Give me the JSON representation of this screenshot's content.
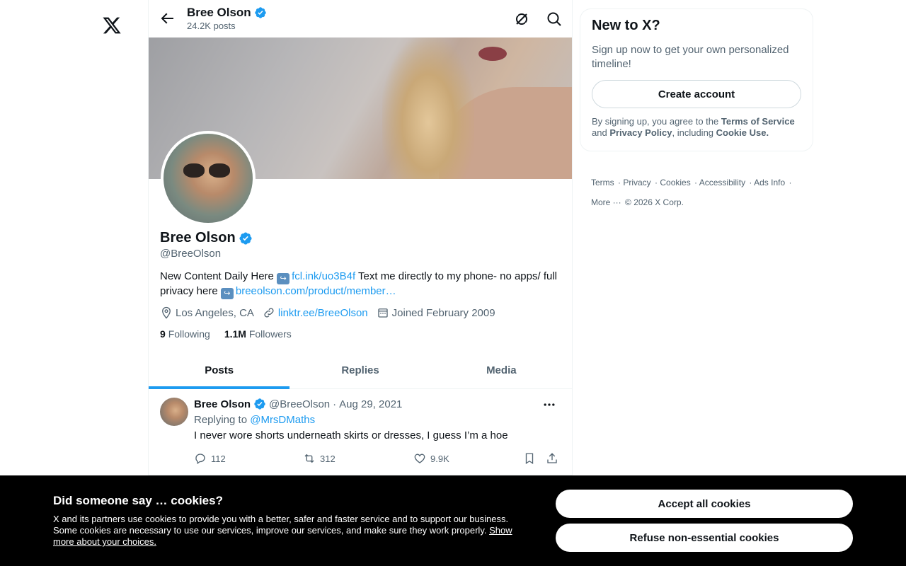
{
  "header": {
    "name": "Bree Olson",
    "posts_count": "24.2K posts"
  },
  "profile": {
    "name": "Bree Olson",
    "handle": "@BreeOlson",
    "bio_part1": "New Content Daily Here ",
    "bio_link1": "fcl.ink/uo3B4f",
    "bio_part2": " Text me directly to my phone- no apps/ full privacy here ",
    "bio_link2": "breeolson.com/product/member…",
    "location": "Los Angeles, CA",
    "website": "linktr.ee/BreeOlson",
    "joined": "Joined February 2009",
    "following_count": "9",
    "following_label": "Following",
    "followers_count": "1.1M",
    "followers_label": "Followers"
  },
  "tabs": [
    {
      "label": "Posts",
      "active": true
    },
    {
      "label": "Replies",
      "active": false
    },
    {
      "label": "Media",
      "active": false
    }
  ],
  "post": {
    "name": "Bree Olson",
    "handle": "@BreeOlson",
    "separator": "·",
    "date": "Aug 29, 2021",
    "replying_prefix": "Replying to ",
    "replying_to": "@MrsDMaths",
    "text": "I never wore shorts underneath skirts or dresses, I guess I’m a hoe",
    "replies": "112",
    "reposts": "312",
    "likes": "9.9K"
  },
  "signup": {
    "title": "New to X?",
    "subtitle": "Sign up now to get your own personalized timeline!",
    "create_button": "Create account",
    "terms_prefix": "By signing up, you agree to the ",
    "terms_link": "Terms of Service",
    "terms_mid": " and ",
    "privacy_link": "Privacy Policy",
    "terms_mid2": ", including ",
    "cookie_link": "Cookie Use."
  },
  "footer": {
    "links": [
      "Terms",
      "Privacy",
      "Cookies",
      "Accessibility",
      "Ads Info"
    ],
    "more": "More ···",
    "copyright": "© 2026 X Corp."
  },
  "cookie_banner": {
    "title": "Did someone say … cookies?",
    "body": "X and its partners use cookies to provide you with a better, safer and faster service and to support our business. Some cookies are necessary to use our services, improve our services, and make sure they work properly. ",
    "link": "Show more about your choices.",
    "accept": "Accept all cookies",
    "refuse": "Refuse non-essential cookies"
  },
  "colors": {
    "accent": "#1d9bf0",
    "text": "#0f1419",
    "muted": "#536471",
    "cookie_bg": "#000000"
  }
}
